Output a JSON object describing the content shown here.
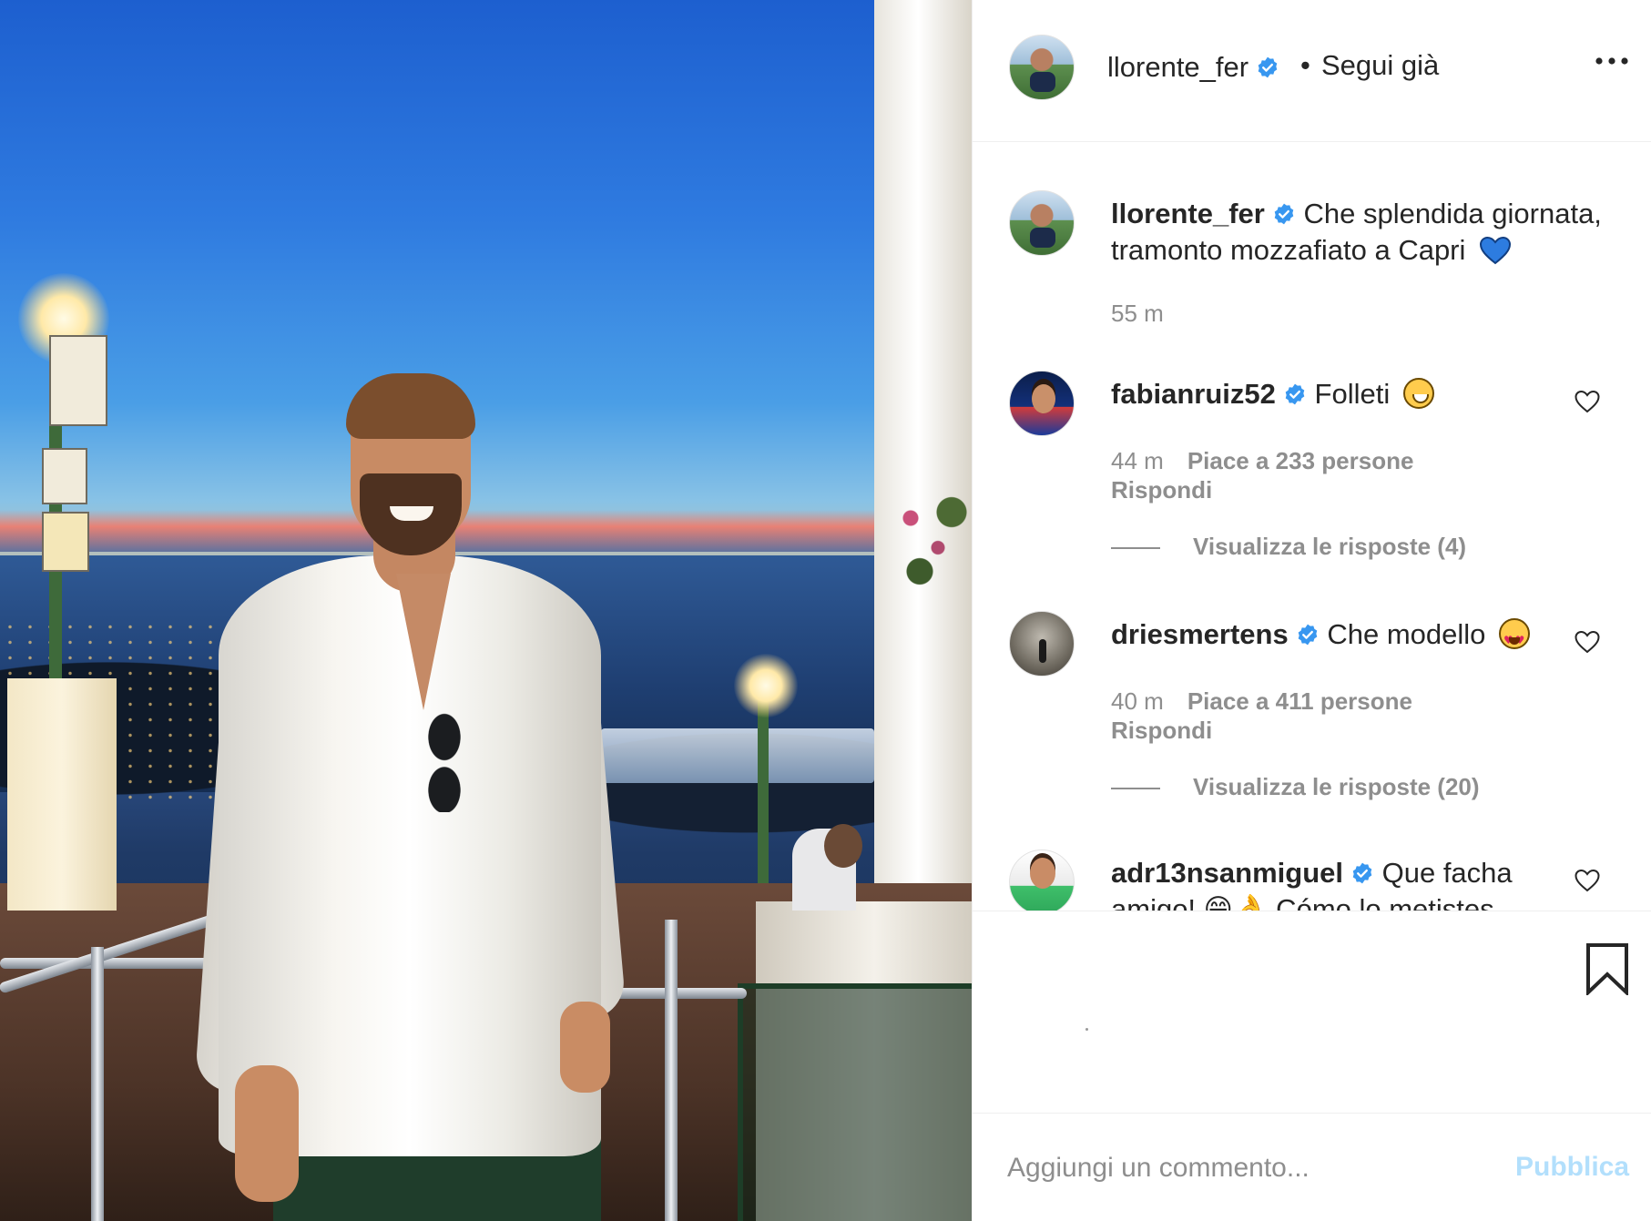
{
  "post": {
    "image_alt": "photo-man-at-capri-sunset"
  },
  "header": {
    "username": "llorente_fer",
    "separator": "•",
    "follow_status": "Segui già",
    "more_icon": "more-horizontal-icon"
  },
  "caption": {
    "username": "llorente_fer",
    "text": "Che splendida giornata, tramonto mozzafiato a Capri",
    "emoji": "blue-heart",
    "time": "55 m"
  },
  "comments": [
    {
      "username": "fabianruiz52",
      "text": "Folleti",
      "emoji": "laughing-face",
      "time": "44 m",
      "likes": "Piace a 233 persone",
      "reply": "Rispondi",
      "view_replies": "Visualizza le risposte (4)"
    },
    {
      "username": "driesmertens",
      "text": "Che modello",
      "emoji": "heart-eyes-face",
      "time": "40 m",
      "likes": "Piace a 411 persone",
      "reply": "Rispondi",
      "view_replies": "Visualizza le risposte (20)"
    },
    {
      "username": "adr13nsanmiguel",
      "text": "Que facha amigo! 😁👌 Cómo lo metistes",
      "emoji": "",
      "time": "",
      "likes": "",
      "reply": ""
    }
  ],
  "actions": {
    "bookmark_icon": "bookmark-icon"
  },
  "composer": {
    "placeholder": "Aggiungi un commento...",
    "value": "",
    "post_label": "Pubblica"
  },
  "colors": {
    "verified": "#3897f0",
    "muted_text": "#8e8e8e",
    "primary_text": "#262626",
    "post_disabled": "#b2dffc",
    "divider": "#efefef"
  }
}
